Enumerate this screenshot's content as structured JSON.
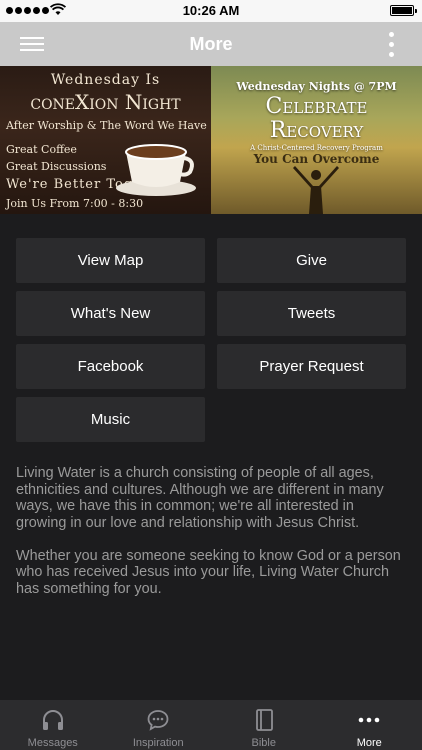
{
  "status_bar": {
    "time": "10:26 AM"
  },
  "nav": {
    "title": "More"
  },
  "banner": {
    "left": {
      "line1": "Wednesday Is",
      "line2": "coneXion Night",
      "line3": "After Worship & The Word We Have",
      "line4": "Great Coffee",
      "line5": "Great Discussions",
      "line6": "We're Better Together",
      "line7": "Join Us From 7:00 - 8:30"
    },
    "right": {
      "line1": "Wednesday Nights @ 7PM",
      "line2": "Celebrate",
      "line3": "Recovery",
      "line4": "A Christ-Centered Recovery Program",
      "line5": "You Can Overcome"
    }
  },
  "buttons": [
    "View Map",
    "Give",
    "What's New",
    "Tweets",
    "Facebook",
    "Prayer Request",
    "Music"
  ],
  "about": {
    "p1": "Living Water is a church consisting of people of all ages, ethnicities and cultures. Although we are different in many ways, we have this in common; we're all interested in growing in our love and relationship with Jesus Christ.",
    "p2": "Whether you are someone seeking to know God or a person who has received Jesus into your life, Living Water Church has something for you."
  },
  "tabs": [
    {
      "label": "Messages",
      "icon": "headphones-icon"
    },
    {
      "label": "Inspiration",
      "icon": "chat-bubble-icon"
    },
    {
      "label": "Bible",
      "icon": "book-icon"
    },
    {
      "label": "More",
      "icon": "more-dots-icon",
      "active": true
    }
  ]
}
